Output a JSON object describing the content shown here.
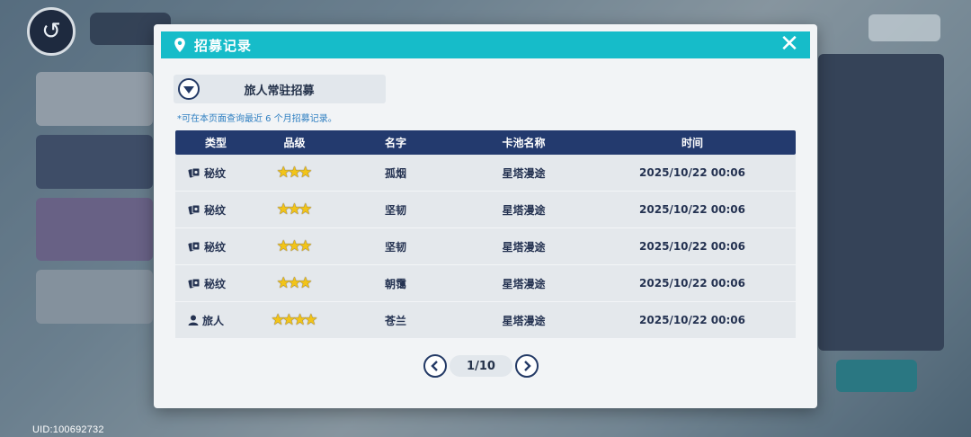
{
  "header": {
    "title": "招募记录"
  },
  "pool_selector": {
    "current": "旅人常驻招募"
  },
  "hint": "*可在本页面查询最近 6 个月招募记录。",
  "table": {
    "columns": [
      "类型",
      "品级",
      "名字",
      "卡池名称",
      "时间"
    ],
    "rows": [
      {
        "type_icon": "card-icon",
        "type": "秘纹",
        "stars": 3,
        "name": "孤烟",
        "pool": "星塔漫途",
        "time": "2025/10/22 00:06"
      },
      {
        "type_icon": "card-icon",
        "type": "秘纹",
        "stars": 3,
        "name": "坚韧",
        "pool": "星塔漫途",
        "time": "2025/10/22 00:06"
      },
      {
        "type_icon": "card-icon",
        "type": "秘纹",
        "stars": 3,
        "name": "坚韧",
        "pool": "星塔漫途",
        "time": "2025/10/22 00:06"
      },
      {
        "type_icon": "card-icon",
        "type": "秘纹",
        "stars": 3,
        "name": "朝霭",
        "pool": "星塔漫途",
        "time": "2025/10/22 00:06"
      },
      {
        "type_icon": "person-icon",
        "type": "旅人",
        "stars": 4,
        "name": "苍兰",
        "pool": "星塔漫途",
        "time": "2025/10/22 00:06"
      }
    ]
  },
  "pager": {
    "page": "1/10"
  },
  "uid": "UID:100692732",
  "colors": {
    "header": "#16bcc9",
    "table_header": "#233a6e",
    "star": "#f2c418"
  }
}
